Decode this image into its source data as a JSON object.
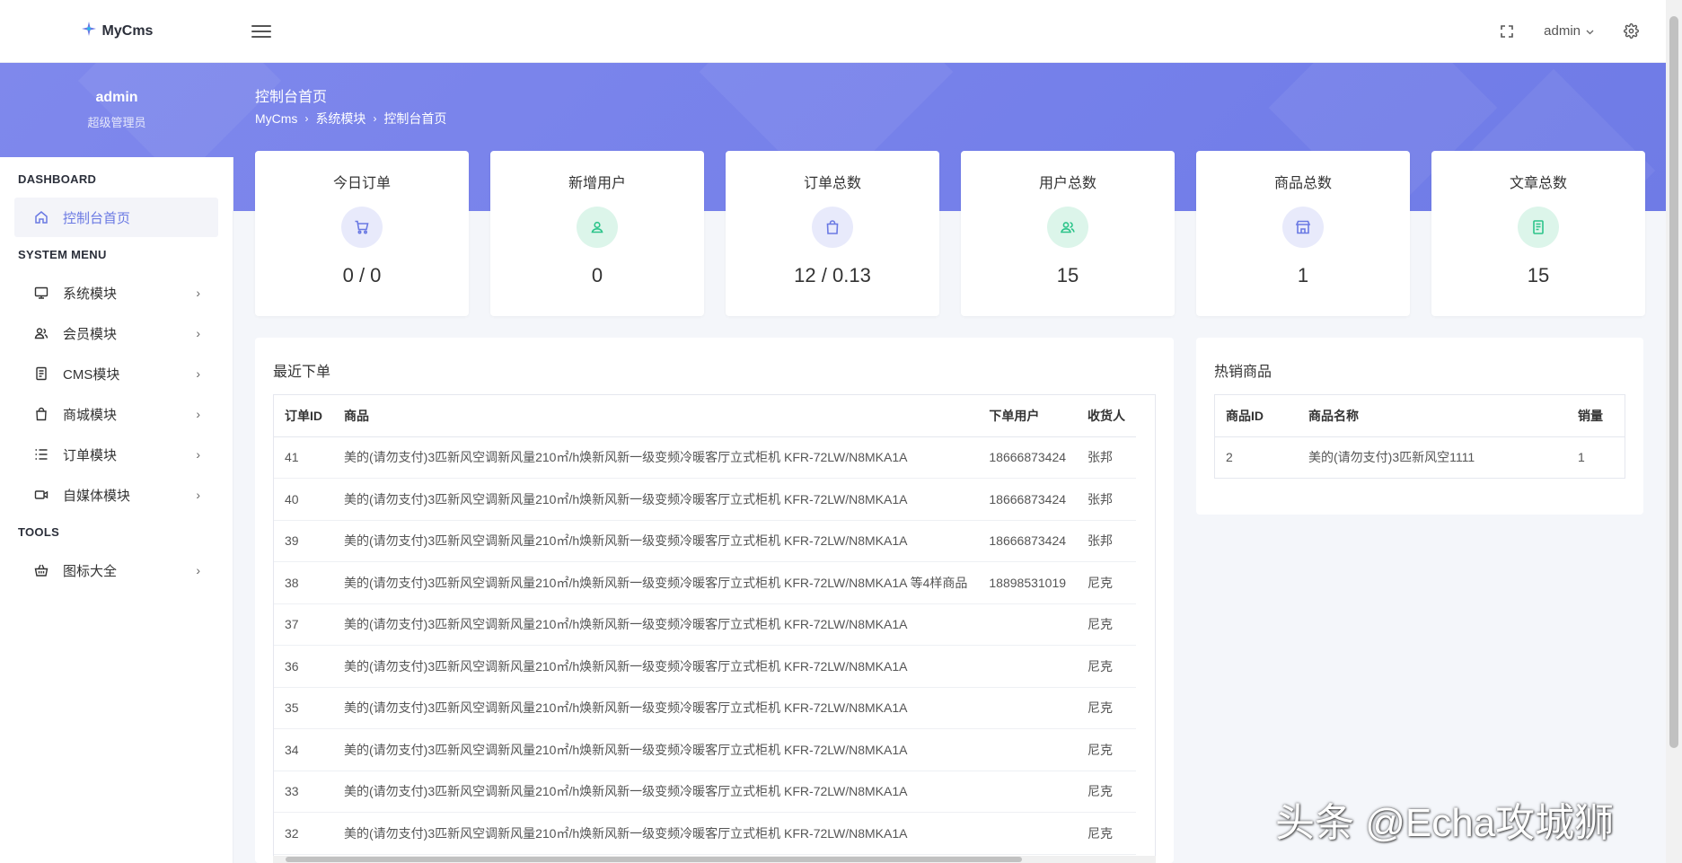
{
  "header": {
    "brand": "MyCms",
    "user": "admin"
  },
  "profile": {
    "name": "admin",
    "role": "超级管理员"
  },
  "hero": {
    "title": "控制台首页",
    "breadcrumb": [
      "MyCms",
      "系统模块",
      "控制台首页"
    ]
  },
  "sidebar": {
    "sections": [
      {
        "title": "DASHBOARD",
        "items": [
          {
            "label": "控制台首页",
            "icon": "home-icon",
            "active": true
          }
        ]
      },
      {
        "title": "SYSTEM MENU",
        "items": [
          {
            "label": "系统模块",
            "icon": "monitor-icon"
          },
          {
            "label": "会员模块",
            "icon": "users-icon"
          },
          {
            "label": "CMS模块",
            "icon": "document-icon"
          },
          {
            "label": "商城模块",
            "icon": "shopping-bag-icon"
          },
          {
            "label": "订单模块",
            "icon": "list-icon"
          },
          {
            "label": "自媒体模块",
            "icon": "video-icon"
          }
        ]
      },
      {
        "title": "TOOLS",
        "items": [
          {
            "label": "图标大全",
            "icon": "basket-icon"
          }
        ]
      }
    ]
  },
  "cards": [
    {
      "title": "今日订单",
      "value": "0 / 0",
      "icon": "cart-icon",
      "color": "#6a79e3",
      "bg": "#e8eafb"
    },
    {
      "title": "新增用户",
      "value": "0",
      "icon": "user-icon",
      "color": "#2cc48a",
      "bg": "#dcf5ea"
    },
    {
      "title": "订单总数",
      "value": "12 / 0.13",
      "icon": "bag-icon",
      "color": "#6a79e3",
      "bg": "#e8eafb"
    },
    {
      "title": "用户总数",
      "value": "15",
      "icon": "users-icon",
      "color": "#2cc48a",
      "bg": "#dcf5ea"
    },
    {
      "title": "商品总数",
      "value": "1",
      "icon": "store-icon",
      "color": "#6a79e3",
      "bg": "#e8eafb"
    },
    {
      "title": "文章总数",
      "value": "15",
      "icon": "article-icon",
      "color": "#2cc48a",
      "bg": "#dcf5ea"
    }
  ],
  "orders": {
    "title": "最近下单",
    "columns": [
      "订单ID",
      "商品",
      "下单用户",
      "收货人"
    ],
    "rows": [
      [
        "41",
        "美的(请勿支付)3匹新风空调新风量210㎡/h焕新风新一级变频冷暖客厅立式柜机 KFR-72LW/N8MKA1A",
        "18666873424",
        "张邦"
      ],
      [
        "40",
        "美的(请勿支付)3匹新风空调新风量210㎡/h焕新风新一级变频冷暖客厅立式柜机 KFR-72LW/N8MKA1A",
        "18666873424",
        "张邦"
      ],
      [
        "39",
        "美的(请勿支付)3匹新风空调新风量210㎡/h焕新风新一级变频冷暖客厅立式柜机 KFR-72LW/N8MKA1A",
        "18666873424",
        "张邦"
      ],
      [
        "38",
        "美的(请勿支付)3匹新风空调新风量210㎡/h焕新风新一级变频冷暖客厅立式柜机 KFR-72LW/N8MKA1A 等4样商品",
        "18898531019",
        "尼克"
      ],
      [
        "37",
        "美的(请勿支付)3匹新风空调新风量210㎡/h焕新风新一级变频冷暖客厅立式柜机 KFR-72LW/N8MKA1A",
        "",
        "尼克"
      ],
      [
        "36",
        "美的(请勿支付)3匹新风空调新风量210㎡/h焕新风新一级变频冷暖客厅立式柜机 KFR-72LW/N8MKA1A",
        "",
        "尼克"
      ],
      [
        "35",
        "美的(请勿支付)3匹新风空调新风量210㎡/h焕新风新一级变频冷暖客厅立式柜机 KFR-72LW/N8MKA1A",
        "",
        "尼克"
      ],
      [
        "34",
        "美的(请勿支付)3匹新风空调新风量210㎡/h焕新风新一级变频冷暖客厅立式柜机 KFR-72LW/N8MKA1A",
        "",
        "尼克"
      ],
      [
        "33",
        "美的(请勿支付)3匹新风空调新风量210㎡/h焕新风新一级变频冷暖客厅立式柜机 KFR-72LW/N8MKA1A",
        "",
        "尼克"
      ],
      [
        "32",
        "美的(请勿支付)3匹新风空调新风量210㎡/h焕新风新一级变频冷暖客厅立式柜机 KFR-72LW/N8MKA1A",
        "",
        "尼克"
      ]
    ]
  },
  "hot": {
    "title": "热销商品",
    "columns": [
      "商品ID",
      "商品名称",
      "销量"
    ],
    "rows": [
      [
        "2",
        "美的(请勿支付)3匹新风空1111",
        "1"
      ]
    ]
  },
  "watermark": "头条 @Echa攻城狮",
  "colors": {
    "accent": "#6a79e3",
    "hero": "#7a84eb",
    "green": "#2cc48a"
  }
}
